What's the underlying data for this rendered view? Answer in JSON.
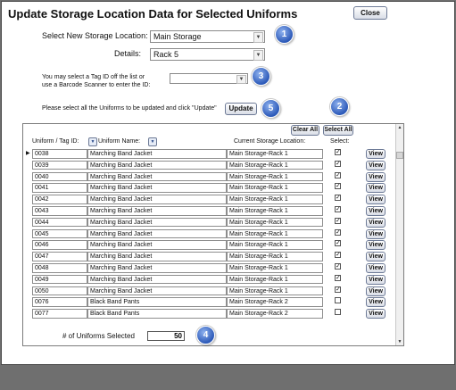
{
  "window": {
    "title": "Update Storage Location Data for Selected Uniforms",
    "close_label": "Close"
  },
  "form": {
    "storage_label": "Select New Storage Location:",
    "storage_value": "Main Storage",
    "details_label": "Details:",
    "details_value": "Rack 5",
    "tag_hint_line1": "You may select a Tag ID off the list or",
    "tag_hint_line2": "use a Barcode Scanner to enter the ID:",
    "tag_value": "",
    "update_hint": "Please select all the Uniforms to be updated and click \"Update\"",
    "update_label": "Update"
  },
  "badges": [
    "1",
    "2",
    "3",
    "4",
    "5"
  ],
  "grid": {
    "clear_all_label": "Clear All",
    "select_all_label": "Select All",
    "headers": {
      "tag": "Uniform / Tag ID:",
      "name": "Uniform Name:",
      "location": "Current Storage Location:",
      "select": "Select:"
    },
    "view_label": "View",
    "rows": [
      {
        "tag": "0038",
        "name": "Marching Band Jacket",
        "location": "Main Storage-Rack 1",
        "selected": true
      },
      {
        "tag": "0039",
        "name": "Marching Band Jacket",
        "location": "Main Storage-Rack 1",
        "selected": true
      },
      {
        "tag": "0040",
        "name": "Marching Band Jacket",
        "location": "Main Storage-Rack 1",
        "selected": true
      },
      {
        "tag": "0041",
        "name": "Marching Band Jacket",
        "location": "Main Storage-Rack 1",
        "selected": true
      },
      {
        "tag": "0042",
        "name": "Marching Band Jacket",
        "location": "Main Storage-Rack 1",
        "selected": true
      },
      {
        "tag": "0043",
        "name": "Marching Band Jacket",
        "location": "Main Storage-Rack 1",
        "selected": true
      },
      {
        "tag": "0044",
        "name": "Marching Band Jacket",
        "location": "Main Storage-Rack 1",
        "selected": true
      },
      {
        "tag": "0045",
        "name": "Marching Band Jacket",
        "location": "Main Storage-Rack 1",
        "selected": true
      },
      {
        "tag": "0046",
        "name": "Marching Band Jacket",
        "location": "Main Storage-Rack 1",
        "selected": true
      },
      {
        "tag": "0047",
        "name": "Marching Band Jacket",
        "location": "Main Storage-Rack 1",
        "selected": true
      },
      {
        "tag": "0048",
        "name": "Marching Band Jacket",
        "location": "Main Storage-Rack 1",
        "selected": true
      },
      {
        "tag": "0049",
        "name": "Marching Band Jacket",
        "location": "Main Storage-Rack 1",
        "selected": true
      },
      {
        "tag": "0050",
        "name": "Marching Band Jacket",
        "location": "Main Storage-Rack 1",
        "selected": true
      },
      {
        "tag": "0076",
        "name": "Black Band Pants",
        "location": "Main Storage-Rack 2",
        "selected": false
      },
      {
        "tag": "0077",
        "name": "Black Band Pants",
        "location": "Main Storage-Rack 2",
        "selected": false
      }
    ]
  },
  "footer": {
    "count_label": "# of Uniforms Selected",
    "count_value": "50"
  },
  "colors": {
    "badge": "#2c59b8",
    "button_border": "#6d7a96"
  }
}
